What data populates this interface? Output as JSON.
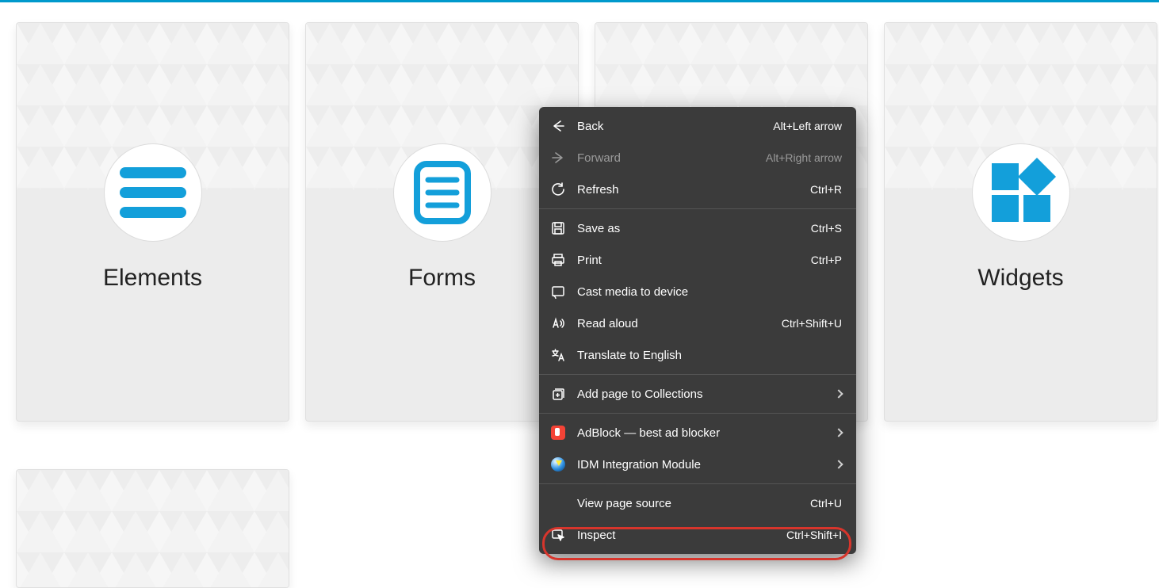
{
  "cards": [
    {
      "title": "Elements"
    },
    {
      "title": "Forms"
    },
    {
      "title": ""
    },
    {
      "title": "Widgets"
    },
    {
      "title": ""
    }
  ],
  "context_menu": {
    "back": {
      "label": "Back",
      "shortcut": "Alt+Left arrow"
    },
    "forward": {
      "label": "Forward",
      "shortcut": "Alt+Right arrow"
    },
    "refresh": {
      "label": "Refresh",
      "shortcut": "Ctrl+R"
    },
    "save_as": {
      "label": "Save as",
      "shortcut": "Ctrl+S"
    },
    "print": {
      "label": "Print",
      "shortcut": "Ctrl+P"
    },
    "cast": {
      "label": "Cast media to device",
      "shortcut": ""
    },
    "read_aloud": {
      "label": "Read aloud",
      "shortcut": "Ctrl+Shift+U"
    },
    "translate": {
      "label": "Translate to English",
      "shortcut": ""
    },
    "collections": {
      "label": "Add page to Collections",
      "shortcut": ""
    },
    "adblock": {
      "label": "AdBlock — best ad blocker",
      "shortcut": ""
    },
    "idm": {
      "label": "IDM Integration Module",
      "shortcut": ""
    },
    "view_source": {
      "label": "View page source",
      "shortcut": "Ctrl+U"
    },
    "inspect": {
      "label": "Inspect",
      "shortcut": "Ctrl+Shift+I"
    }
  }
}
